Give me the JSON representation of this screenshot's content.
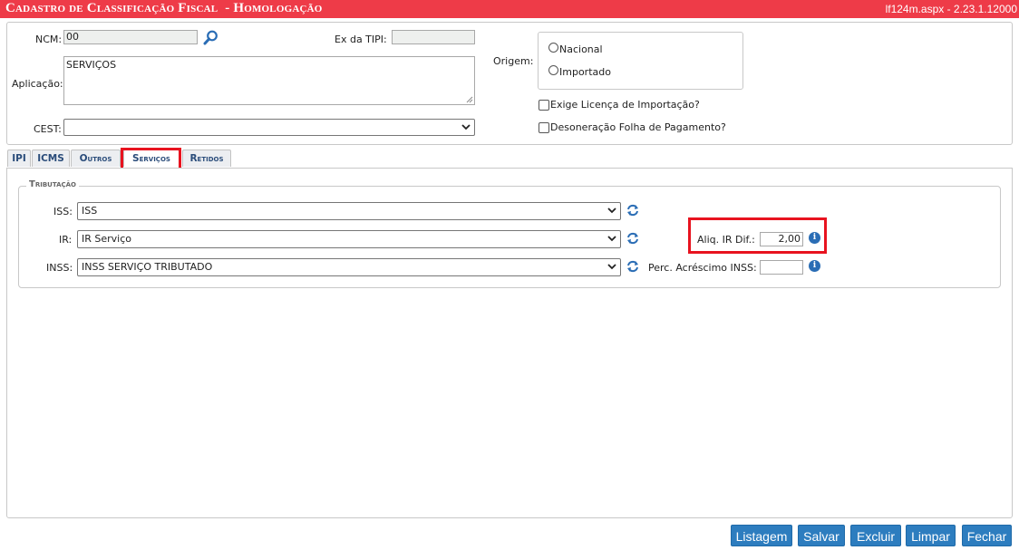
{
  "window": {
    "title": "Cadastro de Classificação Fiscal  - Homologação",
    "version": "lf124m.aspx - 2.23.1.12000"
  },
  "form": {
    "ncm_label": "NCM:",
    "ncm_value": "00",
    "ex_tipi_label": "Ex da TIPI:",
    "ex_tipi_value": "",
    "aplicacao_label": "Aplicação:",
    "aplicacao_value": "SERVIÇOS",
    "cest_label": "CEST:",
    "cest_value": "",
    "origem_label": "Origem:",
    "origem_options": [
      "Nacional",
      "Importado"
    ],
    "exige_licenca_label": "Exige Licença de Importação?",
    "desoneracao_label": "Desoneração Folha de Pagamento?"
  },
  "tabs": [
    {
      "label": "IPI"
    },
    {
      "label": "ICMS"
    },
    {
      "label": "Outros"
    },
    {
      "label": "Serviços",
      "active": true
    },
    {
      "label": "Retidos"
    }
  ],
  "tributacao": {
    "legend": "Tributação",
    "iss_label": "ISS:",
    "iss_value": "ISS",
    "ir_label": "IR:",
    "ir_value": "IR Serviço",
    "inss_label": "INSS:",
    "inss_value": "INSS SERVIÇO TRIBUTADO",
    "aliq_ir_label": "Aliq. IR Dif.:",
    "aliq_ir_value": "2,00",
    "perc_inss_label": "Perc. Acréscimo INSS:",
    "perc_inss_value": ""
  },
  "buttons": {
    "listagem": "Listagem",
    "salvar": "Salvar",
    "excluir": "Excluir",
    "limpar": "Limpar",
    "fechar": "Fechar"
  },
  "colors": {
    "titlebar": "#ee3b48",
    "button": "#2d7dbf",
    "highlight": "#e8131f",
    "tab_text": "#2a4c7a"
  },
  "icons": [
    "search-icon",
    "refresh-icon",
    "info-icon",
    "chevron-down-icon"
  ]
}
